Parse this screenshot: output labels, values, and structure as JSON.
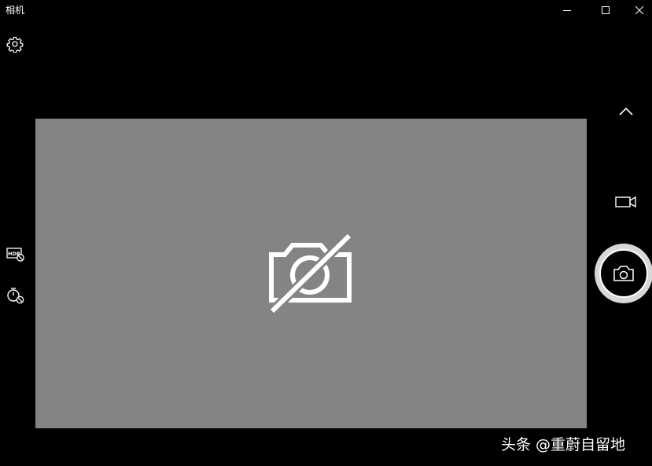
{
  "window": {
    "title": "相机",
    "controls": [
      "minimize",
      "maximize",
      "close"
    ]
  },
  "icons": {
    "settings": "gear-icon",
    "hdr": "hdr-off-icon",
    "timer": "timer-off-icon",
    "expand": "chevron-up-icon",
    "video_mode": "video-camera-icon",
    "photo": "camera-icon",
    "no_camera": "camera-disabled-icon"
  },
  "watermark": "头条 @重蔚自留地",
  "colors": {
    "background": "#000000",
    "preview": "#848484",
    "foreground": "#ffffff"
  }
}
